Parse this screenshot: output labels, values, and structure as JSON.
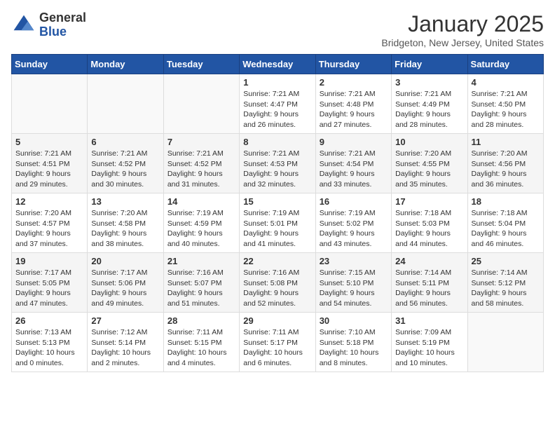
{
  "logo": {
    "general": "General",
    "blue": "Blue"
  },
  "title": "January 2025",
  "subtitle": "Bridgeton, New Jersey, United States",
  "weekdays": [
    "Sunday",
    "Monday",
    "Tuesday",
    "Wednesday",
    "Thursday",
    "Friday",
    "Saturday"
  ],
  "weeks": [
    [
      {
        "day": "",
        "info": ""
      },
      {
        "day": "",
        "info": ""
      },
      {
        "day": "",
        "info": ""
      },
      {
        "day": "1",
        "info": "Sunrise: 7:21 AM\nSunset: 4:47 PM\nDaylight: 9 hours\nand 26 minutes."
      },
      {
        "day": "2",
        "info": "Sunrise: 7:21 AM\nSunset: 4:48 PM\nDaylight: 9 hours\nand 27 minutes."
      },
      {
        "day": "3",
        "info": "Sunrise: 7:21 AM\nSunset: 4:49 PM\nDaylight: 9 hours\nand 28 minutes."
      },
      {
        "day": "4",
        "info": "Sunrise: 7:21 AM\nSunset: 4:50 PM\nDaylight: 9 hours\nand 28 minutes."
      }
    ],
    [
      {
        "day": "5",
        "info": "Sunrise: 7:21 AM\nSunset: 4:51 PM\nDaylight: 9 hours\nand 29 minutes."
      },
      {
        "day": "6",
        "info": "Sunrise: 7:21 AM\nSunset: 4:52 PM\nDaylight: 9 hours\nand 30 minutes."
      },
      {
        "day": "7",
        "info": "Sunrise: 7:21 AM\nSunset: 4:52 PM\nDaylight: 9 hours\nand 31 minutes."
      },
      {
        "day": "8",
        "info": "Sunrise: 7:21 AM\nSunset: 4:53 PM\nDaylight: 9 hours\nand 32 minutes."
      },
      {
        "day": "9",
        "info": "Sunrise: 7:21 AM\nSunset: 4:54 PM\nDaylight: 9 hours\nand 33 minutes."
      },
      {
        "day": "10",
        "info": "Sunrise: 7:20 AM\nSunset: 4:55 PM\nDaylight: 9 hours\nand 35 minutes."
      },
      {
        "day": "11",
        "info": "Sunrise: 7:20 AM\nSunset: 4:56 PM\nDaylight: 9 hours\nand 36 minutes."
      }
    ],
    [
      {
        "day": "12",
        "info": "Sunrise: 7:20 AM\nSunset: 4:57 PM\nDaylight: 9 hours\nand 37 minutes."
      },
      {
        "day": "13",
        "info": "Sunrise: 7:20 AM\nSunset: 4:58 PM\nDaylight: 9 hours\nand 38 minutes."
      },
      {
        "day": "14",
        "info": "Sunrise: 7:19 AM\nSunset: 4:59 PM\nDaylight: 9 hours\nand 40 minutes."
      },
      {
        "day": "15",
        "info": "Sunrise: 7:19 AM\nSunset: 5:01 PM\nDaylight: 9 hours\nand 41 minutes."
      },
      {
        "day": "16",
        "info": "Sunrise: 7:19 AM\nSunset: 5:02 PM\nDaylight: 9 hours\nand 43 minutes."
      },
      {
        "day": "17",
        "info": "Sunrise: 7:18 AM\nSunset: 5:03 PM\nDaylight: 9 hours\nand 44 minutes."
      },
      {
        "day": "18",
        "info": "Sunrise: 7:18 AM\nSunset: 5:04 PM\nDaylight: 9 hours\nand 46 minutes."
      }
    ],
    [
      {
        "day": "19",
        "info": "Sunrise: 7:17 AM\nSunset: 5:05 PM\nDaylight: 9 hours\nand 47 minutes."
      },
      {
        "day": "20",
        "info": "Sunrise: 7:17 AM\nSunset: 5:06 PM\nDaylight: 9 hours\nand 49 minutes."
      },
      {
        "day": "21",
        "info": "Sunrise: 7:16 AM\nSunset: 5:07 PM\nDaylight: 9 hours\nand 51 minutes."
      },
      {
        "day": "22",
        "info": "Sunrise: 7:16 AM\nSunset: 5:08 PM\nDaylight: 9 hours\nand 52 minutes."
      },
      {
        "day": "23",
        "info": "Sunrise: 7:15 AM\nSunset: 5:10 PM\nDaylight: 9 hours\nand 54 minutes."
      },
      {
        "day": "24",
        "info": "Sunrise: 7:14 AM\nSunset: 5:11 PM\nDaylight: 9 hours\nand 56 minutes."
      },
      {
        "day": "25",
        "info": "Sunrise: 7:14 AM\nSunset: 5:12 PM\nDaylight: 9 hours\nand 58 minutes."
      }
    ],
    [
      {
        "day": "26",
        "info": "Sunrise: 7:13 AM\nSunset: 5:13 PM\nDaylight: 10 hours\nand 0 minutes."
      },
      {
        "day": "27",
        "info": "Sunrise: 7:12 AM\nSunset: 5:14 PM\nDaylight: 10 hours\nand 2 minutes."
      },
      {
        "day": "28",
        "info": "Sunrise: 7:11 AM\nSunset: 5:15 PM\nDaylight: 10 hours\nand 4 minutes."
      },
      {
        "day": "29",
        "info": "Sunrise: 7:11 AM\nSunset: 5:17 PM\nDaylight: 10 hours\nand 6 minutes."
      },
      {
        "day": "30",
        "info": "Sunrise: 7:10 AM\nSunset: 5:18 PM\nDaylight: 10 hours\nand 8 minutes."
      },
      {
        "day": "31",
        "info": "Sunrise: 7:09 AM\nSunset: 5:19 PM\nDaylight: 10 hours\nand 10 minutes."
      },
      {
        "day": "",
        "info": ""
      }
    ]
  ]
}
